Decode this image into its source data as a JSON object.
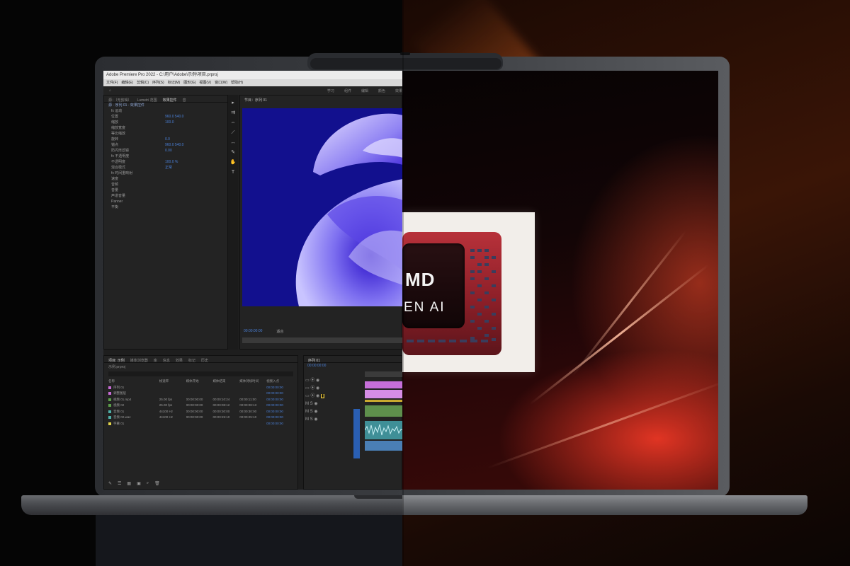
{
  "app": {
    "title": "Adobe Premiere Pro 2022 - C:\\用户\\Adobe\\示例\\项目.prproj",
    "menu": [
      "文件(F)",
      "编辑(E)",
      "剪辑(C)",
      "序列(S)",
      "标记(M)",
      "图形(G)",
      "视图(V)",
      "窗口(W)",
      "帮助(H)"
    ],
    "workspace": [
      "学习",
      "组件",
      "编辑",
      "颜色",
      "效果"
    ]
  },
  "effects_panel": {
    "tabs": [
      "源：（无剪辑）",
      "Lumetri 范围",
      "效果控件",
      "音"
    ],
    "header": "源 · 序列 01 · 效果控件",
    "rows": [
      {
        "label": "fx  运动",
        "value": ""
      },
      {
        "label": "位置",
        "value": "960.0   540.0"
      },
      {
        "label": "缩放",
        "value": "100.0"
      },
      {
        "label": "缩放宽度",
        "value": ""
      },
      {
        "label": "等比缩放",
        "value": ""
      },
      {
        "label": "旋转",
        "value": "0.0"
      },
      {
        "label": "锚点",
        "value": "960.0   540.0"
      },
      {
        "label": "防闪烁滤镜",
        "value": "0.00"
      },
      {
        "label": "fx  不透明度",
        "value": ""
      },
      {
        "label": "不透明度",
        "value": "100.0 %"
      },
      {
        "label": "混合模式",
        "value": "正常"
      },
      {
        "label": "fx  时间重映射",
        "value": ""
      },
      {
        "label": "速度",
        "value": ""
      },
      {
        "label": "音频",
        "value": ""
      },
      {
        "label": "音量",
        "value": ""
      },
      {
        "label": "声道音量",
        "value": ""
      },
      {
        "label": "Panner",
        "value": ""
      },
      {
        "label": "平衡",
        "value": ""
      }
    ]
  },
  "program_monitor": {
    "tab": "节目：序列 01",
    "timecode_left": "00:00:00:00",
    "fit_label": "适合"
  },
  "project_panel": {
    "tabs": [
      "项目: 示例",
      "媒体浏览器",
      "库",
      "信息",
      "效果",
      "标记",
      "历史"
    ],
    "path": "示例.prproj",
    "columns": [
      "名称",
      "帧速率",
      "媒体开始",
      "媒体结束",
      "媒体持续时间",
      "视频入点"
    ],
    "rows": [
      {
        "color": "#c76bd6",
        "name": "序列 01",
        "rate": "",
        "start": "",
        "end": "",
        "dur": "",
        "in": "00:00:00:00"
      },
      {
        "color": "#c76bd6",
        "name": "调整图层",
        "rate": "",
        "start": "",
        "end": "",
        "dur": "",
        "in": "00:00:00:00"
      },
      {
        "color": "#5b9e4a",
        "name": "视频 01.mp4",
        "rate": "25.00 fps",
        "start": "00:00:00:00",
        "end": "00:00:10:24",
        "dur": "00:00:11:00",
        "in": "00:00:00:00"
      },
      {
        "color": "#5b9e4a",
        "name": "视频 02",
        "rate": "25.00 fps",
        "start": "00:00:00:00",
        "end": "00:00:08:12",
        "dur": "00:00:08:13",
        "in": "00:00:00:00"
      },
      {
        "color": "#4fb0a8",
        "name": "音频 01",
        "rate": "44100 Hz",
        "start": "00:00:00:00",
        "end": "00:00:30:00",
        "dur": "00:00:30:00",
        "in": "00:00:00:00"
      },
      {
        "color": "#4fb0a8",
        "name": "音频 02.wav",
        "rate": "44100 Hz",
        "start": "00:00:00:00",
        "end": "00:00:25:10",
        "dur": "00:00:25:10",
        "in": "00:00:00:00"
      },
      {
        "color": "#e0d24a",
        "name": "字幕 01",
        "rate": "",
        "start": "",
        "end": "",
        "dur": "",
        "in": "00:00:00:00"
      }
    ]
  },
  "timeline": {
    "tab": "序列 01",
    "timecode": "00:00:00:00"
  },
  "chip": {
    "brand": "AMD",
    "brand_visible": "MD",
    "sub": "RYZEN AI",
    "sub_visible": "EN AI"
  }
}
